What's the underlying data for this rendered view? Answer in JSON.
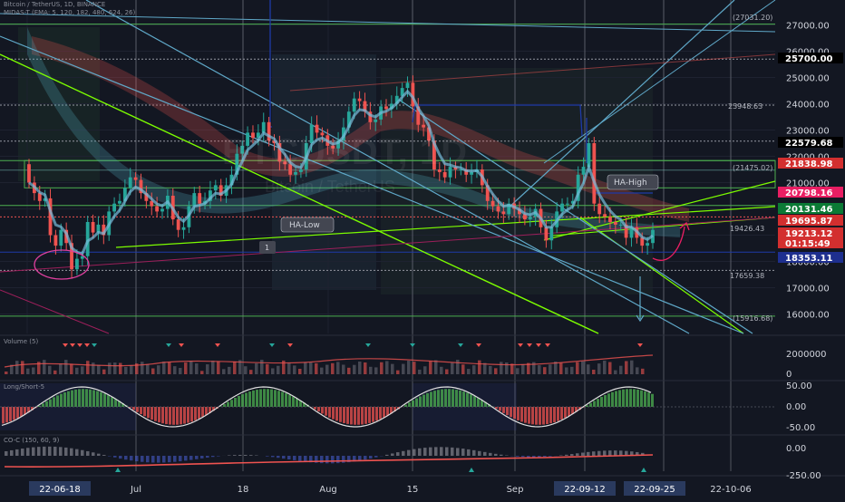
{
  "header": {
    "symbol_line": "Bitcoin / TetherUS, 1D, BINANCE",
    "indicator_line": "MIDAS-T (EMA: 5, 120, 182, 480, 624, 26)"
  },
  "watermark": {
    "symbol": "BTCUSDT, 1D",
    "name": "Bitcoin / TetherUS"
  },
  "panes": {
    "volume": "Volume (5)",
    "longshort": "Long/Short-5",
    "coc": "CO-C (150, 60, 9)"
  },
  "colors": {
    "background": "#131722",
    "up": "#26a69a",
    "down": "#ef5350",
    "green_line": "#4caf50",
    "bright_green": "#7cfc00",
    "blue_line": "#5fa8c8",
    "navy": "#1e3aa8",
    "pink": "#e91e63",
    "label_green": "#0b7a35",
    "label_red": "#d32f2f",
    "label_blue": "#1e2f8f",
    "label_pink": "#e91e63"
  },
  "chart_data": {
    "type": "candlestick",
    "price_axis": {
      "ticks": [
        "27000.00",
        "26000.00",
        "25000.00",
        "24000.00",
        "23000.00",
        "22000.00",
        "21000.00",
        "20000.00",
        "19000.00",
        "18000.00",
        "17000.00",
        "16000.00"
      ]
    },
    "price_labels": [
      {
        "text": "25700.00",
        "style": "dark"
      },
      {
        "text": "22579.68",
        "style": "dark"
      },
      {
        "text": "21838.98",
        "style": "red"
      },
      {
        "text": "20798.16",
        "style": "pink"
      },
      {
        "text": "20131.46",
        "style": "green"
      },
      {
        "text": "19695.87",
        "style": "red"
      },
      {
        "text": "19213.12",
        "style": "red"
      },
      {
        "text": "01:15:49",
        "style": "red"
      },
      {
        "text": "18353.11",
        "style": "blue"
      }
    ],
    "inline_labels": [
      "23948.63",
      "19426.43",
      "17659.38",
      "(21475.02)",
      "(15916.68)",
      "(27031.20)"
    ],
    "annotations": [
      "HA-Low",
      "HA-High",
      "1"
    ],
    "x_axis_labels": [
      {
        "text": "22-06-18",
        "boxed": true
      },
      {
        "text": "Jul",
        "boxed": false
      },
      {
        "text": "18",
        "boxed": false
      },
      {
        "text": "Aug",
        "boxed": false
      },
      {
        "text": "15",
        "boxed": false
      },
      {
        "text": "Sep",
        "boxed": false
      },
      {
        "text": "22-09-12",
        "boxed": true
      },
      {
        "text": "22-09-25",
        "boxed": true
      },
      {
        "text": "22-10-06",
        "boxed": false
      }
    ],
    "volume_axis": [
      "2000000",
      "0"
    ],
    "longshort_axis": [
      "50.00",
      "0.00",
      "-50.00"
    ],
    "coc_axis": [
      "0.00",
      "-250.00"
    ],
    "closes": [
      21000,
      20600,
      20300,
      20400,
      19000,
      18600,
      19200,
      18700,
      17700,
      18100,
      18200,
      19500,
      19100,
      19400,
      19000,
      19900,
      20200,
      20300,
      20800,
      21200,
      21100,
      20600,
      20300,
      20100,
      19900,
      20000,
      20500,
      19600,
      19200,
      19300,
      20100,
      20600,
      20200,
      20300,
      20700,
      20900,
      20500,
      20900,
      21300,
      22100,
      22400,
      22900,
      22700,
      22900,
      23300,
      22600,
      22500,
      21800,
      21700,
      21300,
      21400,
      21500,
      22500,
      23200,
      22900,
      22800,
      22400,
      22300,
      22600,
      23100,
      23700,
      24200,
      24100,
      23700,
      23300,
      23400,
      23900,
      23800,
      24000,
      24300,
      24600,
      24800,
      23900,
      23200,
      23100,
      22600,
      21500,
      21400,
      21200,
      21600,
      21500,
      21500,
      21300,
      21400,
      21500,
      20900,
      20300,
      20100,
      19900,
      19800,
      20200,
      20000,
      19800,
      19600,
      19700,
      20000,
      19300,
      18800,
      19300,
      19900,
      20200,
      20200,
      20300,
      21300,
      21600,
      22500,
      20200,
      19800,
      19700,
      19500,
      19400,
      19400,
      18900,
      19300,
      18900,
      18600,
      18700,
      19200
    ]
  }
}
